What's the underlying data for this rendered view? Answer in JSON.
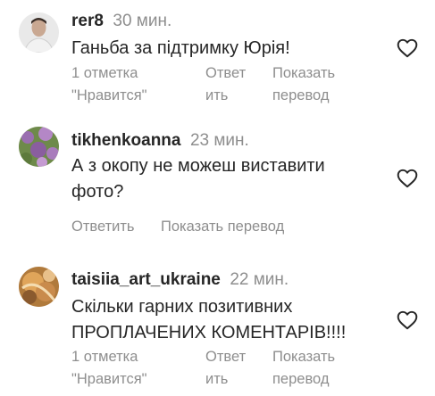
{
  "comments": [
    {
      "username": "rer8",
      "time": "30 мин.",
      "text": "Ганьба за підтримку Юрія!",
      "likes": "1 отметка \"Нравится\"",
      "likes_line1": "1 отметка",
      "likes_line2": "\"Нравится\"",
      "reply_line1": "Ответ",
      "reply_line2": "ить",
      "translate_line1": "Показать",
      "translate_line2": "перевод",
      "avatar_icon": "avatar-man-photo"
    },
    {
      "username": "tikhenkoanna",
      "time": "23 мин.",
      "text": "А з окопу не можеш виставити фото?",
      "reply": "Ответить",
      "translate": "Показать перевод",
      "avatar_icon": "avatar-flowers-photo"
    },
    {
      "username": "taisiia_art_ukraine",
      "time": "22 мин.",
      "text": "Скільки гарних позитивних ПРОПЛАЧЕНИХ КОМЕНТАРІВ!!!!",
      "likes_line1": "1 отметка",
      "likes_line2": "\"Нравится\"",
      "reply_line1": "Ответ",
      "reply_line2": "ить",
      "translate_line1": "Показать",
      "translate_line2": "перевод",
      "avatar_icon": "avatar-art-photo"
    }
  ],
  "icons": {
    "like": "heart-outline-icon"
  },
  "colors": {
    "primary_text": "#262626",
    "secondary_text": "#8e8e8e"
  }
}
